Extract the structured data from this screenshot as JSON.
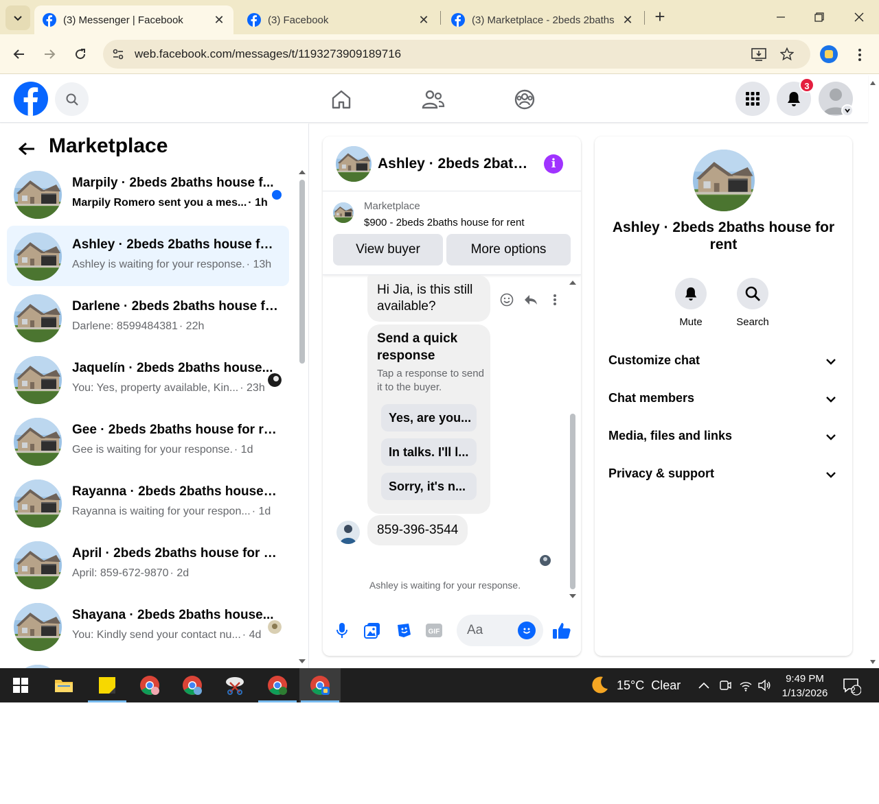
{
  "browser": {
    "tabs": [
      {
        "title": "(3) Messenger | Facebook",
        "active": true
      },
      {
        "title": "(3) Facebook",
        "active": false
      },
      {
        "title": "(3) Marketplace - 2beds 2baths",
        "active": false
      }
    ],
    "url": "web.facebook.com/messages/t/1193273909189716"
  },
  "fb_header": {
    "notification_count": "3"
  },
  "left_panel": {
    "title": "Marketplace",
    "conversations": [
      {
        "name": "Marpily · 2beds 2baths house f...",
        "preview": "Marpily Romero sent you a mes...",
        "time": " · 1h",
        "unread": true,
        "selected": false
      },
      {
        "name": "Ashley · 2beds 2baths house for ...",
        "preview": "Ashley is waiting for your response.",
        "time": " · 13h",
        "unread": false,
        "selected": true
      },
      {
        "name": "Darlene · 2beds 2baths house fo...",
        "preview": "Darlene: 8599484381",
        "time": " · 22h",
        "unread": false,
        "selected": false
      },
      {
        "name": "Jaquelín · 2beds 2baths house...",
        "preview": "You: Yes, property available, Kin...",
        "time": " · 23h",
        "unread": false,
        "selected": false
      },
      {
        "name": "Gee · 2beds 2baths house for rent",
        "preview": "Gee is waiting for your response.",
        "time": " · 1d",
        "unread": false,
        "selected": false
      },
      {
        "name": "Rayanna · 2beds 2baths house f...",
        "preview": "Rayanna is waiting for your respon...",
        "time": " · 1d",
        "unread": false,
        "selected": false
      },
      {
        "name": "April · 2beds 2baths house for r...",
        "preview": "April: 859-672-9870",
        "time": " · 2d",
        "unread": false,
        "selected": false
      },
      {
        "name": "Shayana · 2beds 2baths house...",
        "preview": "You: Kindly send your contact nu...",
        "time": " · 4d",
        "unread": false,
        "selected": false
      }
    ]
  },
  "chat": {
    "name": "Ashley · 2beds 2bath...",
    "info_glyph": "i",
    "marketplace_label": "Marketplace",
    "listing": "$900 - 2beds 2baths house for rent",
    "view_buyer": "View buyer",
    "more_options": "More options",
    "first_message": "Hi Jia, is this still available?",
    "quick_response": {
      "title": "Send a quick response",
      "subtitle": "Tap a response to send it to the buyer.",
      "options": [
        "Yes, are you...",
        "In talks. I'll l...",
        "Sorry, it's n..."
      ]
    },
    "phone_message": "859-396-3544",
    "waiting_text": "Ashley is waiting for your response.",
    "composer_placeholder": "Aa"
  },
  "info_panel": {
    "name": "Ashley · 2beds 2baths house for rent",
    "mute_label": "Mute",
    "search_label": "Search",
    "sections": [
      "Customize chat",
      "Chat members",
      "Media, files and links",
      "Privacy & support"
    ]
  },
  "taskbar": {
    "weather": "15°C  Clear",
    "time": "9:49 PM",
    "date": "1/13/2026",
    "notification_count": "2"
  },
  "colors": {
    "fb_blue": "#0866ff",
    "selected_row": "#ebf5ff",
    "info_purple": "#a033ff",
    "badge_red": "#e41e3f",
    "tab_strip": "#f1e9c9"
  }
}
